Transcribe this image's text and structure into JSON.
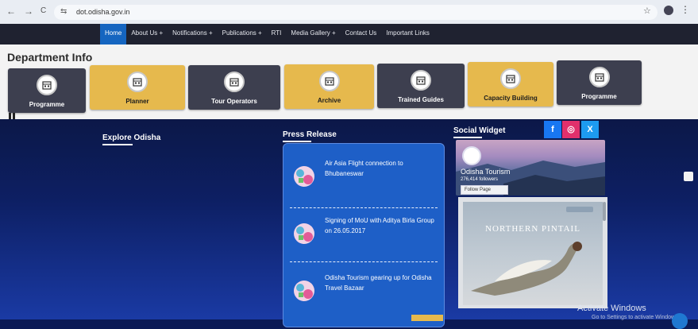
{
  "browser": {
    "url": "dot.odisha.gov.in",
    "back_icon": "←",
    "forward_icon": "→",
    "reload_icon": "C",
    "tune_icon": "⇆",
    "star_icon": "☆",
    "menu_icon": "⋮"
  },
  "menu": {
    "items": [
      "Home",
      "About Us +",
      "Notifications +",
      "Publications +",
      "RTI",
      "Media Gallery +",
      "Contact Us",
      "Important Links"
    ]
  },
  "department": {
    "title": "Department Info",
    "tiles": [
      {
        "label": "Programme",
        "style": "dark",
        "icon": "calendar-icon"
      },
      {
        "label": "Planner",
        "style": "gold",
        "icon": "planner-icon"
      },
      {
        "label": "Tour Operators",
        "style": "dark",
        "icon": "tour-operator-icon"
      },
      {
        "label": "Archive",
        "style": "gold",
        "icon": "archive-icon"
      },
      {
        "label": "Trained Guides",
        "style": "dark",
        "icon": "guide-icon"
      },
      {
        "label": "Capacity Building",
        "style": "gold",
        "icon": "building-icon"
      },
      {
        "label": "Programme",
        "style": "dark",
        "icon": "calendar-icon"
      }
    ]
  },
  "explore": {
    "title": "Explore Odisha"
  },
  "press": {
    "title": "Press Release",
    "items": [
      "Air Asia Flight connection to Bhubaneswar",
      "Signing of MoU with Aditya Birla Group on 26.05.2017",
      "Odisha Tourism gearing up for Odisha Travel Bazaar"
    ]
  },
  "social": {
    "title": "Social Widget",
    "icons": [
      {
        "name": "facebook-icon",
        "glyph": "f",
        "color": "#1877f2"
      },
      {
        "name": "instagram-icon",
        "glyph": "◎",
        "color": "#e1306c"
      },
      {
        "name": "x-icon",
        "glyph": "X",
        "color": "#1d9bf0"
      }
    ],
    "fb_page": {
      "name": "Odisha Tourism",
      "followers": "276,414 followers",
      "follow_label": "Follow Page"
    },
    "feed_title": "NORTHERN PINTAIL"
  },
  "watermark": {
    "title": "Activate Windows",
    "subtitle": "Go to Settings to activate Windows."
  },
  "colors": {
    "menu_active": "#1565c0",
    "tile_dark": "#3d3f4f",
    "tile_gold": "#e6b94d",
    "press_card": "#1e5fc7"
  }
}
